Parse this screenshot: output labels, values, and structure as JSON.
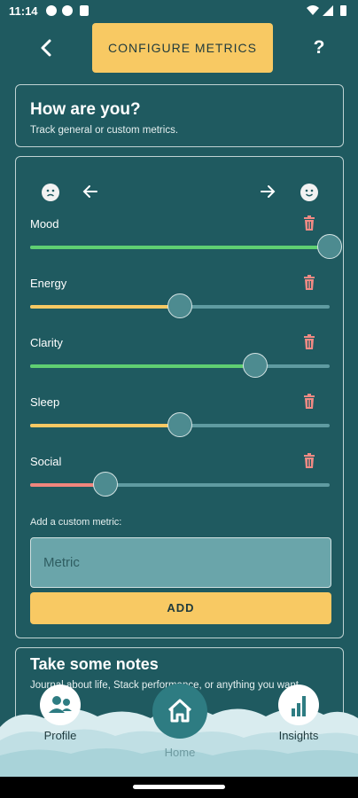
{
  "status": {
    "time": "11:14"
  },
  "header": {
    "back_icon": "arrow-left-icon",
    "title_button": "CONFIGURE METRICS",
    "help_label": "?"
  },
  "intro": {
    "title": "How are you?",
    "subtitle": "Track general or custom metrics."
  },
  "metrics_card": {
    "scale": {
      "left_icon": "sad-face-icon",
      "right_icon": "happy-face-icon"
    },
    "metrics": [
      {
        "label": "Mood",
        "value": 1.0,
        "color": "#5fcf72"
      },
      {
        "label": "Energy",
        "value": 0.5,
        "color": "#f8c963"
      },
      {
        "label": "Clarity",
        "value": 0.75,
        "color": "#5fcf72"
      },
      {
        "label": "Sleep",
        "value": 0.5,
        "color": "#f8c963"
      },
      {
        "label": "Social",
        "value": 0.25,
        "color": "#f0867d"
      }
    ],
    "custom_label": "Add a custom metric:",
    "custom_placeholder": "Metric",
    "add_label": "ADD"
  },
  "notes": {
    "title": "Take some notes",
    "subtitle": "Journal about life, Stack performance, or anything you want."
  },
  "nav": [
    {
      "label": "Profile",
      "icon": "profile-icon"
    },
    {
      "label": "Home",
      "icon": "home-icon"
    },
    {
      "label": "Insights",
      "icon": "bar-chart-icon"
    }
  ],
  "colors": {
    "background": "#1f5a60",
    "accent": "#f8c963",
    "trash": "#f08a84",
    "track": "#5f9ba1"
  }
}
